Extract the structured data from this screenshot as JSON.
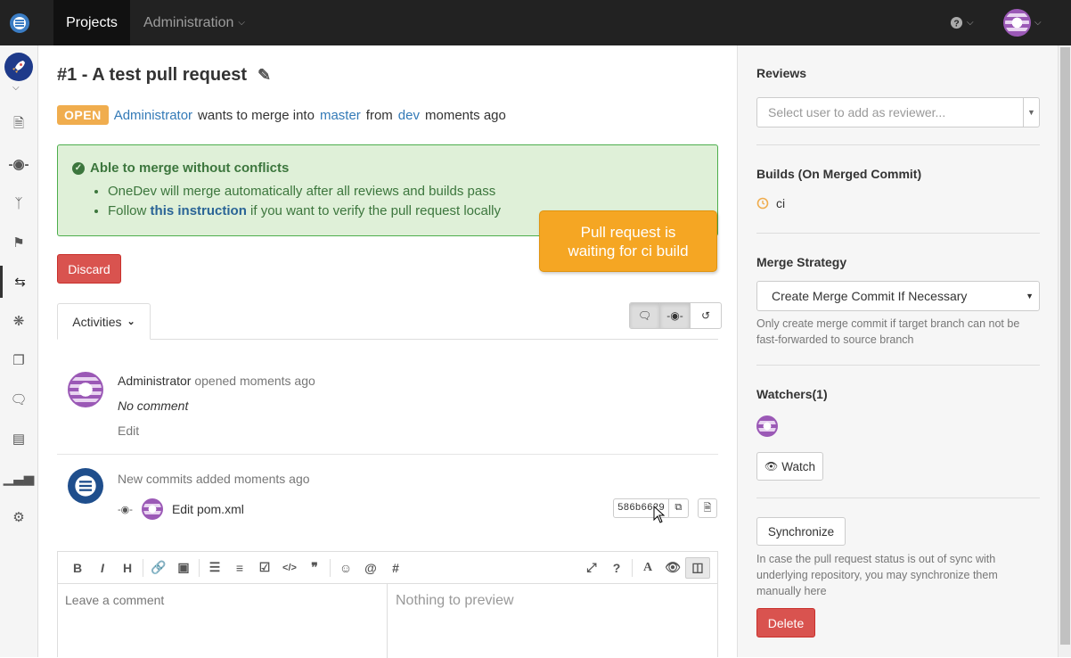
{
  "topbar": {
    "nav": [
      "Projects",
      "Administration"
    ],
    "help_icon": "question-circle-icon",
    "user_avatar": "user-avatar"
  },
  "sidebar": {
    "items": [
      "file-icon",
      "commit-icon",
      "branch-icon",
      "tag-icon",
      "pull-request-icon",
      "bug-icon",
      "cubes-icon",
      "comments-icon",
      "build-list-icon",
      "stats-icon",
      "gear-icon"
    ]
  },
  "pr": {
    "title": "#1 - A test pull request",
    "status": "OPEN",
    "author": "Administrator",
    "wants": "wants to merge into",
    "target": "master",
    "from": "from",
    "source": "dev",
    "when": "moments ago"
  },
  "merge_box": {
    "heading": "Able to merge without conflicts",
    "line1": "OneDev will merge automatically after all reviews and builds pass",
    "line2_pre": "Follow",
    "line2_link": "this instruction",
    "line2_post": "if you want to verify the pull request locally"
  },
  "callout": {
    "line1": "Pull request is",
    "line2": "waiting for ci build"
  },
  "actions": {
    "discard": "Discard"
  },
  "activities": {
    "tab_label": "Activities",
    "items": [
      {
        "user": "Administrator",
        "action": "opened moments ago",
        "body": "No comment",
        "edit": "Edit"
      },
      {
        "summary": "New commits added moments ago",
        "commit_msg": "Edit pom.xml",
        "sha": "586b6629"
      }
    ]
  },
  "editor": {
    "placeholder": "Leave a comment",
    "preview": "Nothing to preview"
  },
  "right": {
    "reviews_title": "Reviews",
    "reviewer_placeholder": "Select user to add as reviewer...",
    "builds_title": "Builds (On Merged Commit)",
    "build_name": "ci",
    "strategy_title": "Merge Strategy",
    "strategy_value": "Create Merge Commit If Necessary",
    "strategy_help": "Only create merge commit if target branch can not be fast-forwarded to source branch",
    "watchers_title": "Watchers(1)",
    "watch_label": "Watch",
    "sync_label": "Synchronize",
    "sync_help": "In case the pull request status is out of sync with underlying repository, you may synchronize them manually here",
    "delete_label": "Delete"
  },
  "colors": {
    "open": "#f0ad4e",
    "danger": "#d9534f",
    "success_bg": "#dff0d8",
    "link": "#337ab7",
    "callout": "#f5a623"
  }
}
